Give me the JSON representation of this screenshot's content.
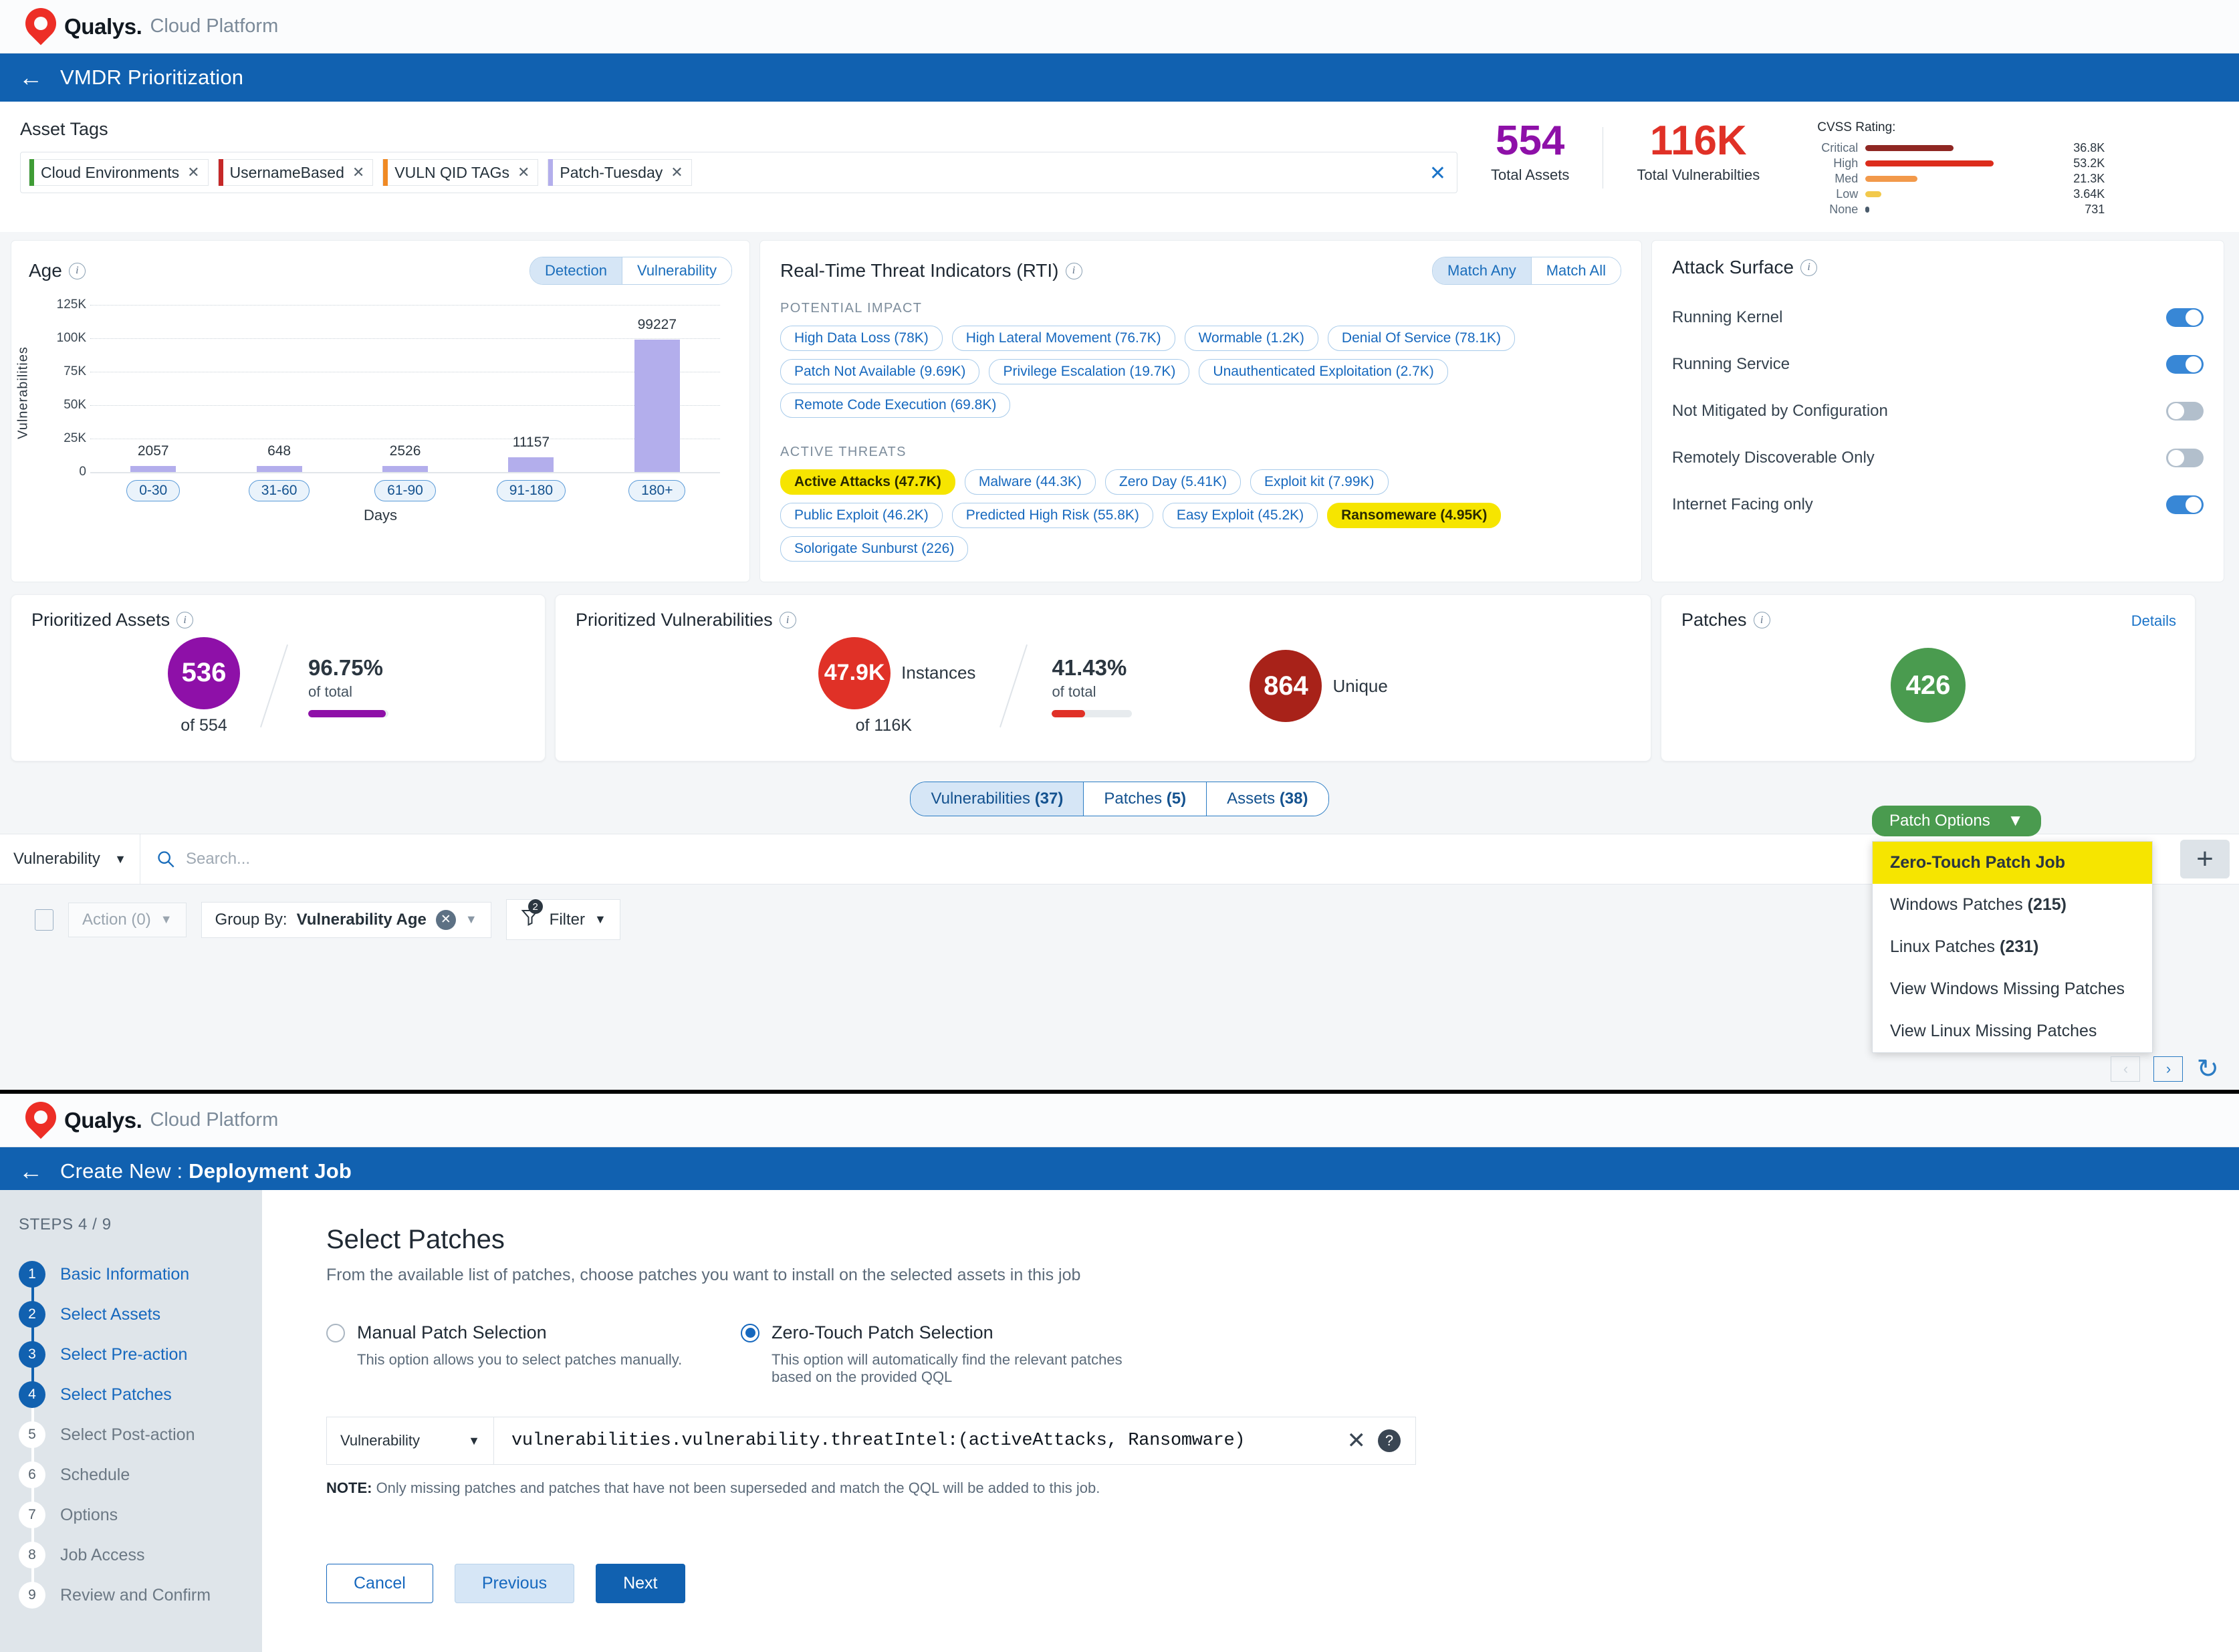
{
  "brand": {
    "name": "Qualys.",
    "suffix": "Cloud Platform"
  },
  "window1": {
    "title": "VMDR Prioritization",
    "asset_tags": {
      "label": "Asset Tags",
      "clear_icon": "clear-icon",
      "chips": [
        {
          "label": "Cloud Environments",
          "color": "#3f9c35"
        },
        {
          "label": "UsernameBased",
          "color": "#c62828"
        },
        {
          "label": "VULN QID TAGs",
          "color": "#f08a24"
        },
        {
          "label": "Patch-Tuesday",
          "color": "#b3aeec"
        }
      ]
    },
    "stats": {
      "total_assets": {
        "value": "554",
        "label": "Total Assets",
        "color": "#8e10a8"
      },
      "total_vulns": {
        "value": "116K",
        "label": "Total Vulnerabilties",
        "color": "#e03127"
      }
    },
    "cvss": {
      "heading": "CVSS Rating:",
      "rows": [
        {
          "label": "Critical",
          "value": "36.8K",
          "bar_pct": 66,
          "color": "#8f2723"
        },
        {
          "label": "High",
          "value": "53.2K",
          "bar_pct": 96,
          "color": "#dc2c1c"
        },
        {
          "label": "Med",
          "value": "21.3K",
          "bar_pct": 39,
          "color": "#f2994a"
        },
        {
          "label": "Low",
          "value": "3.64K",
          "bar_pct": 12,
          "color": "#f2c94c"
        },
        {
          "label": "None",
          "value": "731",
          "bar_pct": 1.5,
          "color": "#4a5b6b"
        }
      ]
    },
    "age_panel": {
      "title": "Age",
      "info_icon": "info-icon",
      "toggle": {
        "options": [
          "Detection",
          "Vulnerability"
        ],
        "selected": "Detection"
      }
    },
    "rti_panel": {
      "title": "Real-Time Threat Indicators (RTI)",
      "info_icon": "info-icon",
      "match_toggle": {
        "options": [
          "Match Any",
          "Match All"
        ],
        "selected": "Match Any"
      },
      "potential_impact_label": "POTENTIAL IMPACT",
      "potential_impact": [
        {
          "label": "High Data Loss (78K)",
          "selected": false
        },
        {
          "label": "High Lateral Movement (76.7K)",
          "selected": false
        },
        {
          "label": "Wormable (1.2K)",
          "selected": false
        },
        {
          "label": "Denial Of Service (78.1K)",
          "selected": false
        },
        {
          "label": "Patch Not Available (9.69K)",
          "selected": false
        },
        {
          "label": "Privilege Escalation (19.7K)",
          "selected": false
        },
        {
          "label": "Unauthenticated Exploitation (2.7K)",
          "selected": false
        },
        {
          "label": "Remote Code Execution (69.8K)",
          "selected": false
        }
      ],
      "active_threats_label": "ACTIVE THREATS",
      "active_threats": [
        {
          "label": "Active Attacks (47.7K)",
          "selected": true
        },
        {
          "label": "Malware (44.3K)",
          "selected": false
        },
        {
          "label": "Zero Day (5.41K)",
          "selected": false
        },
        {
          "label": "Exploit kit (7.99K)",
          "selected": false
        },
        {
          "label": "Public Exploit (46.2K)",
          "selected": false
        },
        {
          "label": "Predicted High Risk (55.8K)",
          "selected": false
        },
        {
          "label": "Easy Exploit (45.2K)",
          "selected": false
        },
        {
          "label": "Ransomeware (4.95K)",
          "selected": true
        },
        {
          "label": "Solorigate Sunburst (226)",
          "selected": false
        }
      ]
    },
    "attack_surface": {
      "title": "Attack Surface",
      "info_icon": "info-icon",
      "rows": [
        {
          "label": "Running Kernel",
          "on": true
        },
        {
          "label": "Running Service",
          "on": true
        },
        {
          "label": "Not Mitigated by Configuration",
          "on": false
        },
        {
          "label": "Remotely Discoverable Only",
          "on": false
        },
        {
          "label": "Internet Facing only",
          "on": true
        }
      ]
    },
    "kpi": {
      "prioritized_assets": {
        "title": "Prioritized Assets",
        "circle_value": "536",
        "circle_color": "#8e10a8",
        "of_text": "of 554",
        "pct": "96.75%",
        "pct_sub": "of total",
        "fill_pct": 96.75
      },
      "prioritized_vulns": {
        "title": "Prioritized Vulnerabilities",
        "circle_value": "47.9K",
        "circle_label": "Instances",
        "circle_color": "#e03127",
        "of_text": "of 116K",
        "pct": "41.43%",
        "pct_sub": "of total",
        "fill_pct": 41.43,
        "unique_value": "864",
        "unique_label": "Unique",
        "unique_color": "#a82219"
      },
      "patches": {
        "title": "Patches",
        "details_link": "Details",
        "circle_value": "426",
        "circle_color": "#4a9b4f",
        "button_label": "Patch Options",
        "menu": [
          {
            "label": "Zero-Touch Patch Job",
            "count": "",
            "highlight": true
          },
          {
            "label": "Windows Patches ",
            "count": "(215)",
            "highlight": false
          },
          {
            "label": "Linux Patches ",
            "count": "(231)",
            "highlight": false
          },
          {
            "label": "View Windows Missing Patches",
            "count": "",
            "highlight": false
          },
          {
            "label": "View Linux Missing Patches",
            "count": "",
            "highlight": false
          }
        ]
      }
    },
    "tabs": [
      {
        "label": "Vulnerabilities ",
        "count": "(37)",
        "selected": true
      },
      {
        "label": "Patches ",
        "count": "(5)",
        "selected": false
      },
      {
        "label": "Assets ",
        "count": "(38)",
        "selected": false
      }
    ],
    "searchbar": {
      "select_value": "Vulnerability",
      "placeholder": "Search...",
      "search_icon": "search-icon",
      "add_icon": "plus-icon"
    },
    "toolbar": {
      "action_label": "Action (0)",
      "groupby_prefix": "Group By: ",
      "groupby_value": "Vulnerability Age",
      "filter_label": "Filter",
      "filter_count": "2"
    }
  },
  "window2": {
    "title_prefix": "Create New : ",
    "title_bold": "Deployment Job",
    "steps_header": "STEPS 4 / 9",
    "steps": [
      {
        "n": "1",
        "label": "Basic Information",
        "done": true
      },
      {
        "n": "2",
        "label": "Select Assets",
        "done": true
      },
      {
        "n": "3",
        "label": "Select Pre-action",
        "done": true
      },
      {
        "n": "4",
        "label": "Select Patches",
        "done": true
      },
      {
        "n": "5",
        "label": "Select Post-action",
        "done": false
      },
      {
        "n": "6",
        "label": "Schedule",
        "done": false
      },
      {
        "n": "7",
        "label": "Options",
        "done": false
      },
      {
        "n": "8",
        "label": "Job Access",
        "done": false
      },
      {
        "n": "9",
        "label": "Review and Confirm",
        "done": false
      }
    ],
    "main": {
      "heading": "Select Patches",
      "description": "From the available list of patches, choose patches you want to install on the selected assets in this job",
      "option_manual": {
        "label": "Manual Patch Selection",
        "sub": "This option allows you to select patches manually.",
        "selected": false
      },
      "option_zero": {
        "label": "Zero-Touch Patch Selection",
        "sub": "This option will automatically find the relevant patches based on the provided QQL",
        "selected": true
      },
      "qql": {
        "select_value": "Vulnerability",
        "query": "vulnerabilities.vulnerability.threatIntel:(activeAttacks, Ransomware)",
        "clear_icon": "clear-icon",
        "help_icon": "help-icon"
      },
      "note_label": "NOTE:",
      "note_text": " Only missing patches and patches that have not been superseded and match the QQL will be added to this job.",
      "buttons": {
        "cancel": "Cancel",
        "previous": "Previous",
        "next": "Next"
      }
    }
  },
  "chart_data": {
    "type": "bar",
    "title": "Age",
    "categories": [
      "0-30",
      "31-60",
      "61-90",
      "91-180",
      "180+"
    ],
    "values": [
      2057,
      648,
      2526,
      11157,
      99227
    ],
    "value_labels": [
      "2057",
      "648",
      "2526",
      "11157",
      "99227"
    ],
    "xlabel": "Days",
    "ylabel": "Vulnerabilities",
    "ylim": [
      0,
      125000
    ],
    "yticks": [
      0,
      25000,
      50000,
      75000,
      100000,
      125000
    ],
    "ytick_labels": [
      "0",
      "25K",
      "50K",
      "75K",
      "100K",
      "125K"
    ],
    "grid": true,
    "bar_color": "#b3aeec",
    "legend": "none"
  }
}
